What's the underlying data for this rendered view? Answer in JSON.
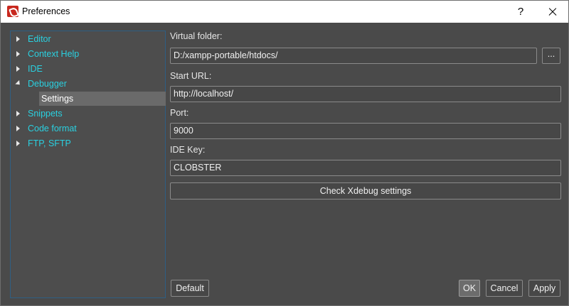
{
  "window": {
    "title": "Preferences",
    "help_label": "?",
    "icons": {
      "app": "app-logo-icon",
      "close": "close-icon"
    }
  },
  "tree": {
    "items": [
      {
        "label": "Editor",
        "expanded": false
      },
      {
        "label": "Context Help",
        "expanded": false
      },
      {
        "label": "IDE",
        "expanded": false
      },
      {
        "label": "Debugger",
        "expanded": true,
        "children": [
          {
            "label": "Settings",
            "selected": true
          }
        ]
      },
      {
        "label": "Snippets",
        "expanded": false
      },
      {
        "label": "Code format",
        "expanded": false
      },
      {
        "label": "FTP, SFTP",
        "expanded": false
      }
    ]
  },
  "form": {
    "virtual_folder": {
      "label": "Virtual folder:",
      "value": "D:/xampp-portable/htdocs/",
      "browse_label": "..."
    },
    "start_url": {
      "label": "Start URL:",
      "value": "http://localhost/"
    },
    "port": {
      "label": "Port:",
      "value": "9000"
    },
    "ide_key": {
      "label": "IDE Key:",
      "value": "CLOBSTER"
    },
    "check_button": "Check Xdebug settings"
  },
  "footer": {
    "default_label": "Default",
    "ok_label": "OK",
    "cancel_label": "Cancel",
    "apply_label": "Apply"
  },
  "colors": {
    "background": "#4a4a4a",
    "tree_link": "#2ad0e0",
    "selection": "#6a6a6a",
    "tree_border": "#2e5f84"
  }
}
